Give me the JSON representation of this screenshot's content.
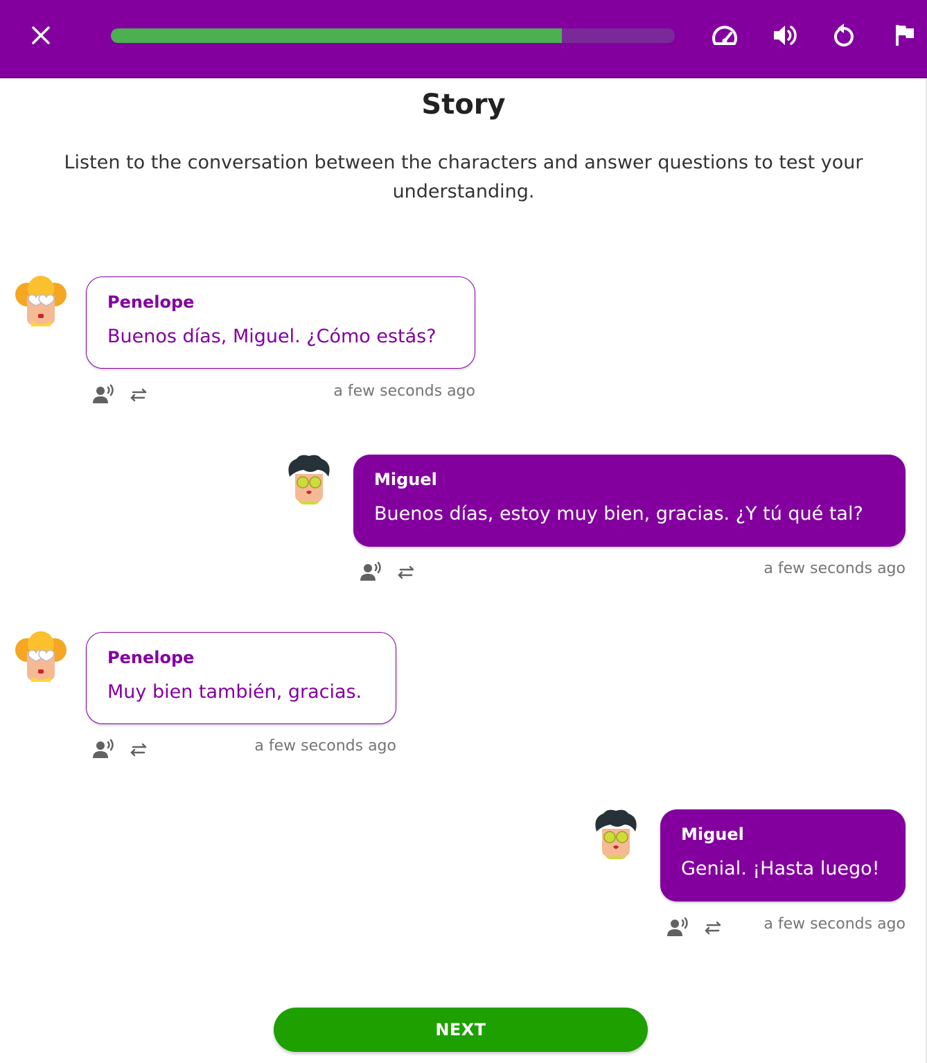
{
  "header": {
    "close_icon": "close-icon",
    "progress": 0.8,
    "progress_color": "#4caf50",
    "bar_color": "#83009f",
    "icons": [
      "speed-icon",
      "volume-icon",
      "replay-icon",
      "flag-icon"
    ]
  },
  "page": {
    "title": "Story",
    "subtitle": "Listen to the conversation between the characters and answer questions to test your understanding."
  },
  "messages": [
    {
      "speaker": "Penelope",
      "text": "Buenos días, Miguel. ¿Cómo estás?",
      "time": "a few seconds ago",
      "side": "left"
    },
    {
      "speaker": "Miguel",
      "text": "Buenos días, estoy muy bien, gracias. ¿Y tú qué tal?",
      "time": "a few seconds ago",
      "side": "right"
    },
    {
      "speaker": "Penelope",
      "text": "Muy bien también, gracias.",
      "time": "a few seconds ago",
      "side": "left"
    },
    {
      "speaker": "Miguel",
      "text": "Genial. ¡Hasta luego!",
      "time": "a few seconds ago",
      "side": "right"
    }
  ],
  "footer": {
    "next_label": "NEXT",
    "next_color": "#1ea000"
  }
}
